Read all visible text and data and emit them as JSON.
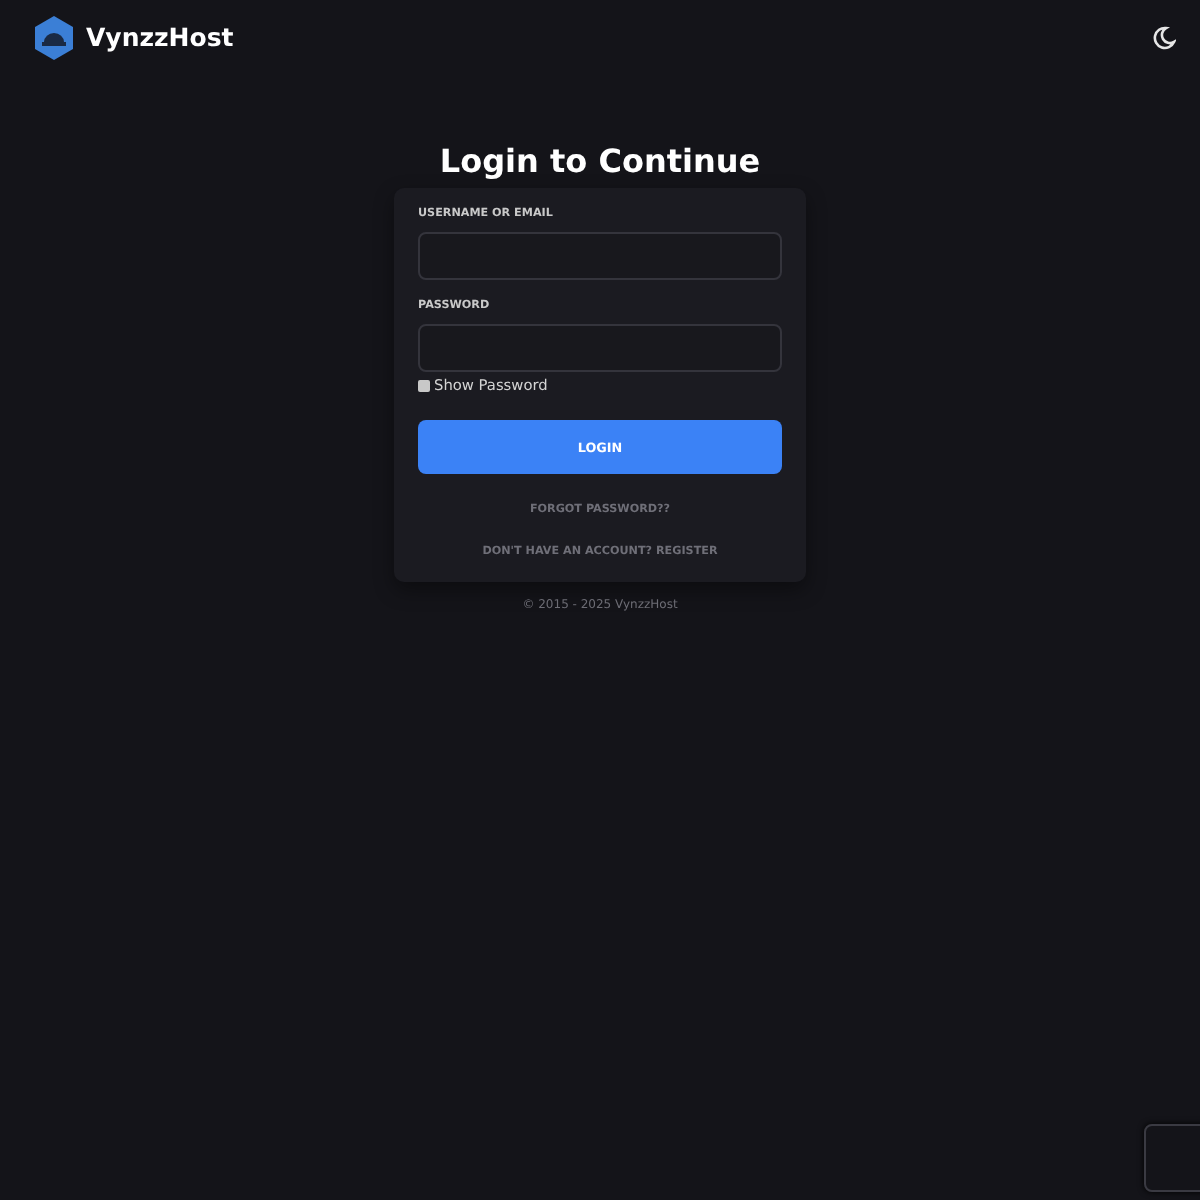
{
  "header": {
    "brand": "VynzzHost"
  },
  "title": "Login to Continue",
  "form": {
    "fields": [
      {
        "label": "USERNAME OR EMAIL"
      },
      {
        "label": "PASSWORD"
      }
    ],
    "show_password": {
      "label": "Show Password",
      "checked": false
    },
    "submit": "LOGIN",
    "links": [
      "FORGOT PASSWORD??",
      "DON'T HAVE AN ACCOUNT? REGISTER"
    ]
  },
  "footer": "© 2015 - 2025 VynzzHost"
}
